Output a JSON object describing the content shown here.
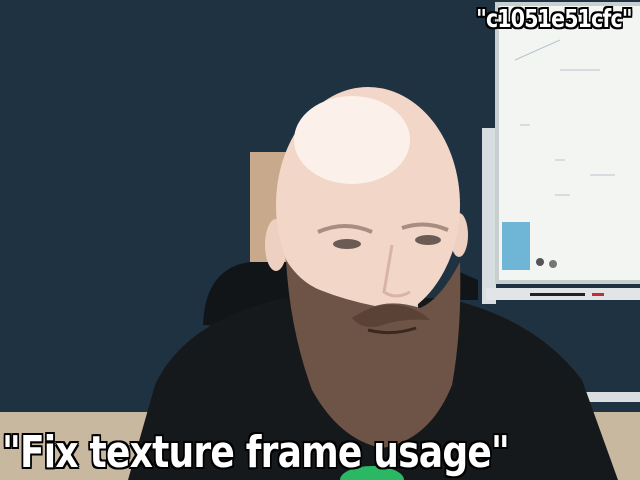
{
  "caption": {
    "top_right": "\"c1051e51cfc\"",
    "bottom": "\"Fix texture frame usage\""
  },
  "colors": {
    "wall": "#1f3242",
    "whiteboard": "#f3f5f2",
    "shirt": "#16191c",
    "skin": "#f2d6c8",
    "beard": "#6e5446",
    "floor": "#c9b8a0",
    "caption_fill": "#ffffff",
    "caption_outline": "#000000"
  }
}
